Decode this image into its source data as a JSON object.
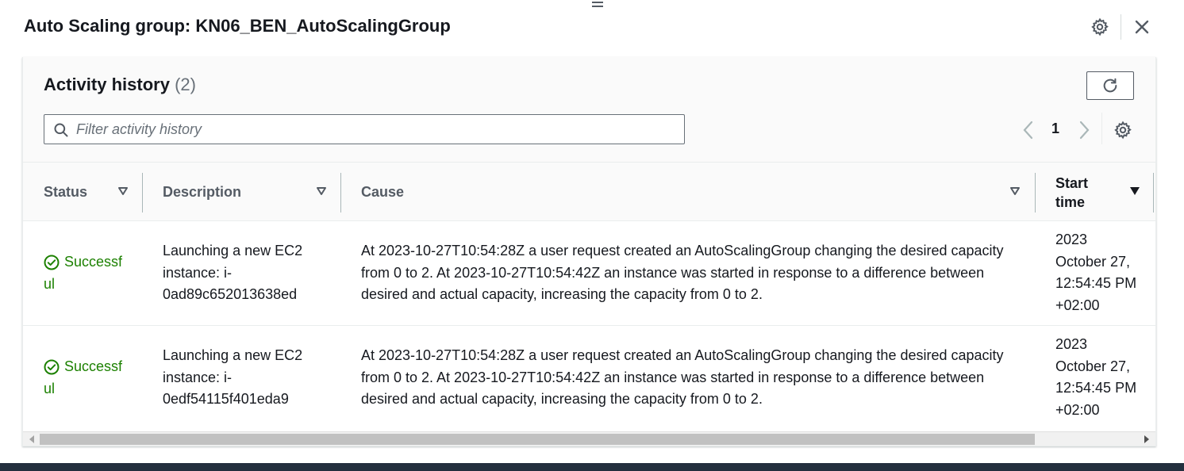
{
  "panel": {
    "title": "Auto Scaling group: KN06_BEN_AutoScalingGroup"
  },
  "activity": {
    "heading": "Activity history",
    "count": "(2)",
    "search_placeholder": "Filter activity history",
    "search_value": "",
    "current_page": "1"
  },
  "table": {
    "columns": [
      {
        "label": "Status"
      },
      {
        "label": "Description"
      },
      {
        "label": "Cause"
      },
      {
        "label_line1": "Start",
        "label_line2": "time"
      }
    ],
    "rows": [
      {
        "status_line1": "Successf",
        "status_line2": "ul",
        "description_lines": [
          "Launching a new EC2",
          "instance: i-",
          "0ad89c652013638ed"
        ],
        "cause_lines": [
          "At 2023-10-27T10:54:28Z a user request created an AutoScalingGroup changing the desired capacity",
          "from 0 to 2. At 2023-10-27T10:54:42Z an instance was started in response to a difference between",
          "desired and actual capacity, increasing the capacity from 0 to 2."
        ],
        "start_time_lines": [
          "2023",
          "October 27,",
          "12:54:45 PM",
          "+02:00"
        ]
      },
      {
        "status_line1": "Successf",
        "status_line2": "ul",
        "description_lines": [
          "Launching a new EC2",
          "instance: i-",
          "0edf54115f401eda9"
        ],
        "cause_lines": [
          "At 2023-10-27T10:54:28Z a user request created an AutoScalingGroup changing the desired capacity",
          "from 0 to 2. At 2023-10-27T10:54:42Z an instance was started in response to a difference between",
          "desired and actual capacity, increasing the capacity from 0 to 2."
        ],
        "start_time_lines": [
          "2023",
          "October 27,",
          "12:54:45 PM",
          "+02:00"
        ]
      }
    ]
  },
  "colors": {
    "success": "#1d8102",
    "text": "#16191f",
    "header_text": "#545b64",
    "footer": "#232f3e"
  },
  "icons": [
    "gear-icon",
    "close-icon",
    "refresh-icon",
    "search-icon",
    "chevron-left-icon",
    "chevron-right-icon",
    "sort-icon",
    "success-check-icon"
  ]
}
